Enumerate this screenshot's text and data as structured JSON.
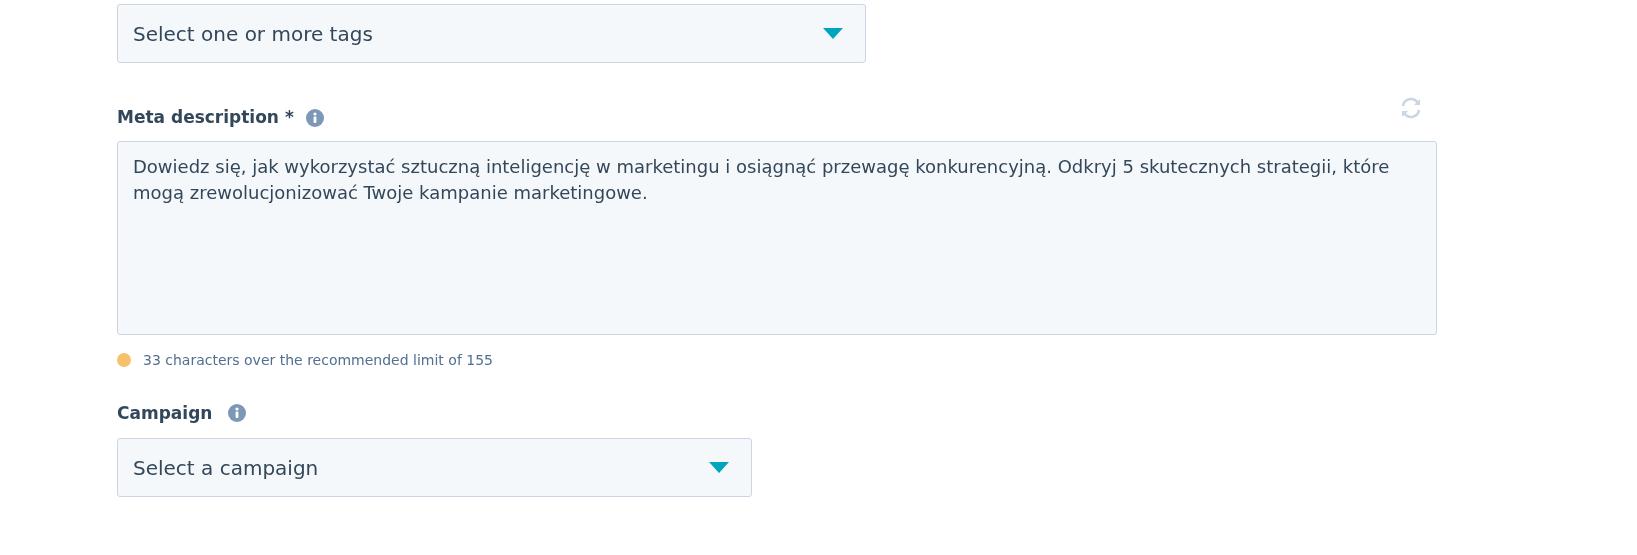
{
  "tags_field": {
    "placeholder": "Select one or more tags"
  },
  "meta_description": {
    "label": "Meta description *",
    "value": "Dowiedz się, jak wykorzystać sztuczną inteligencję w marketingu i osiągnąć przewagę konkurencyjną. Odkryj 5 skutecznych strategii, które mogą zrewolucjonizować Twoje kampanie marketingowe.",
    "warning": {
      "text": "33 characters over the recommended limit of 155",
      "color": "#f5c26b"
    }
  },
  "campaign_field": {
    "label": "Campaign",
    "placeholder": "Select a campaign"
  }
}
